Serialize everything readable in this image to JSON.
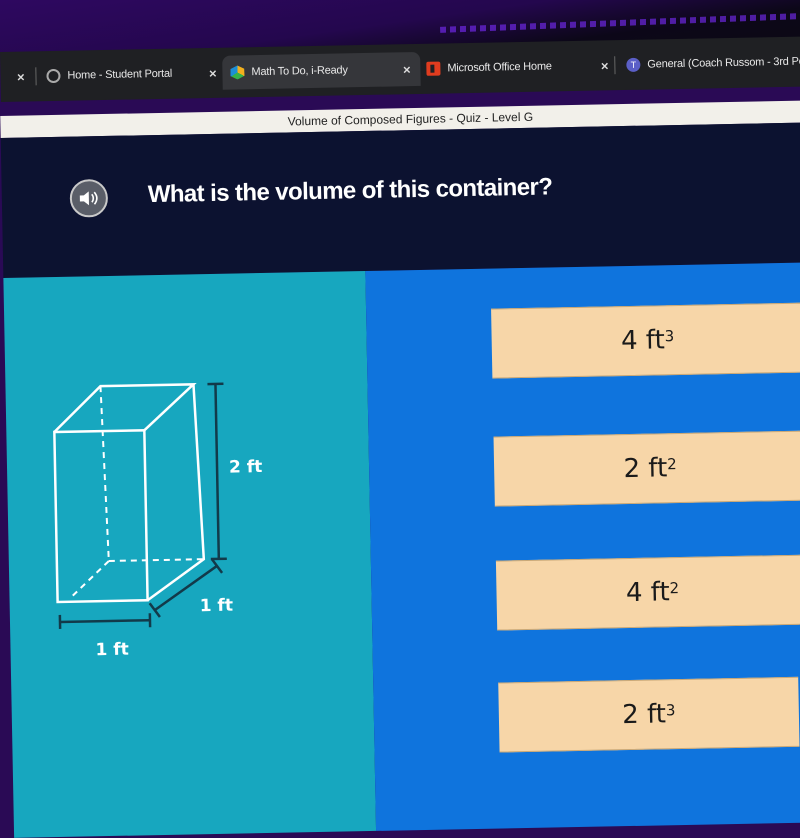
{
  "browser": {
    "tabs": [
      {
        "label": "Home - Student Portal",
        "icon": "globe-icon",
        "active": false
      },
      {
        "label": "Math To Do, i-Ready",
        "icon": "iready-icon",
        "active": true
      },
      {
        "label": "Microsoft Office Home",
        "icon": "office-icon",
        "active": false
      },
      {
        "label": "General (Coach Russom - 3rd Per",
        "icon": "teams-icon",
        "active": false
      }
    ],
    "close_glyph": "×"
  },
  "quiz": {
    "title": "Volume of Composed Figures - Quiz - Level G",
    "question": "What is the volume of this container?",
    "audio_button": "speaker-icon"
  },
  "figure": {
    "shape": "rectangular prism",
    "height_label": "2 ft",
    "depth_label": "1 ft",
    "width_label": "1 ft"
  },
  "answers": [
    {
      "number": "4",
      "unit": "ft",
      "exponent": "3"
    },
    {
      "number": "2",
      "unit": "ft",
      "exponent": "2"
    },
    {
      "number": "4",
      "unit": "ft",
      "exponent": "2"
    },
    {
      "number": "2",
      "unit": "ft",
      "exponent": "3"
    }
  ],
  "colors": {
    "left_panel": "#17a7bf",
    "right_panel": "#0f74dd",
    "answer_card": "#f7d6a8",
    "header": "#0c1230"
  }
}
